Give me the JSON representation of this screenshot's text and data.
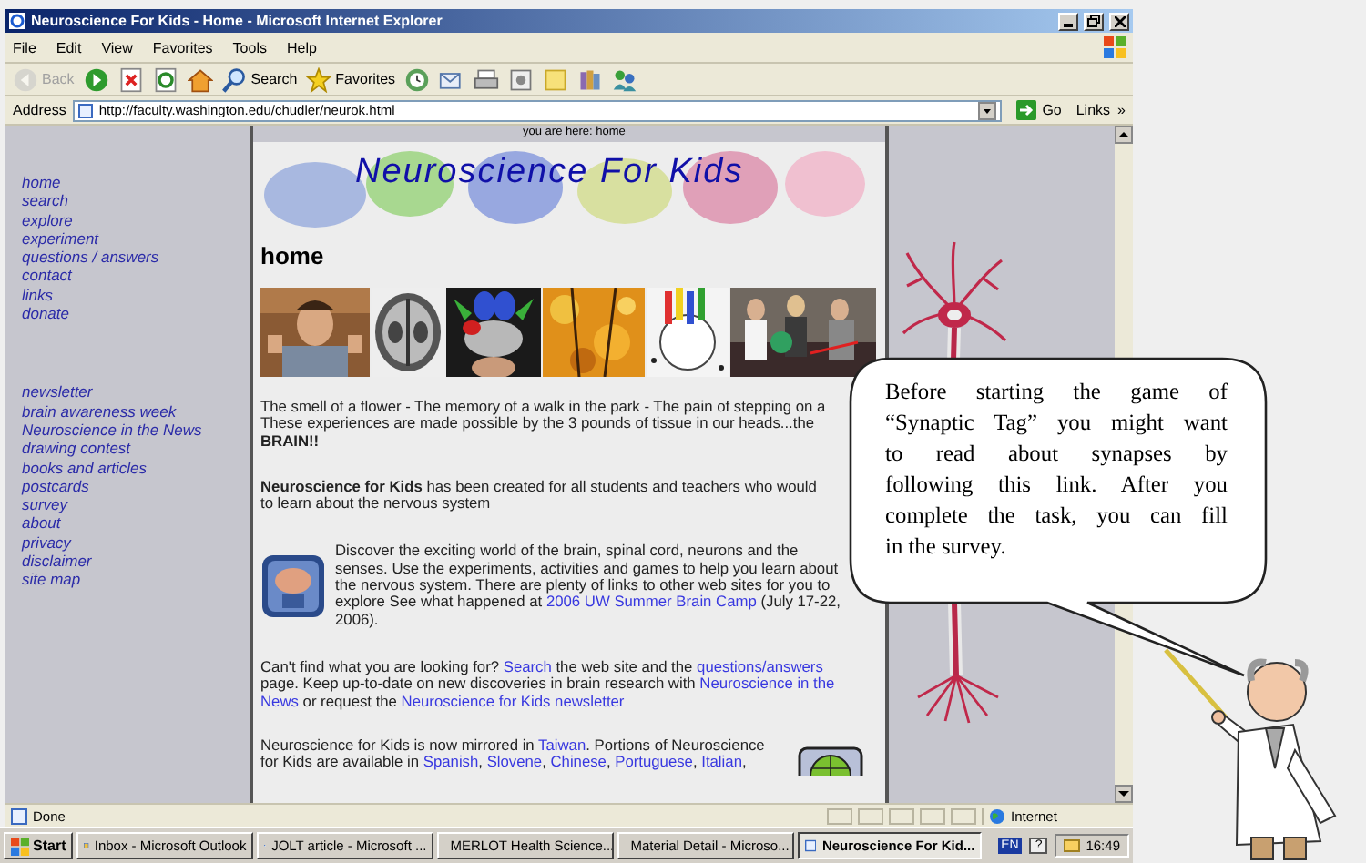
{
  "window": {
    "title": "Neuroscience For Kids - Home - Microsoft Internet Explorer"
  },
  "menu": [
    "File",
    "Edit",
    "View",
    "Favorites",
    "Tools",
    "Help"
  ],
  "toolbar": [
    {
      "kind": "back",
      "label": "Back",
      "disabled": true
    },
    {
      "kind": "forward",
      "disabled": false
    },
    {
      "kind": "stop",
      "disabled": false
    },
    {
      "kind": "refresh",
      "disabled": false
    },
    {
      "kind": "home",
      "disabled": false
    },
    {
      "kind": "search",
      "label": "Search",
      "disabled": false
    },
    {
      "kind": "favorites",
      "label": "Favorites",
      "disabled": false
    },
    {
      "kind": "history",
      "disabled": false
    },
    {
      "kind": "mail",
      "disabled": false
    },
    {
      "kind": "print",
      "disabled": false
    },
    {
      "kind": "edit",
      "disabled": false
    },
    {
      "kind": "note",
      "disabled": false
    },
    {
      "kind": "research",
      "disabled": false
    },
    {
      "kind": "messenger",
      "disabled": false
    }
  ],
  "address": {
    "label": "Address",
    "value": "http://faculty.washington.edu/chudler/neurok.html",
    "go": "Go",
    "links": "Links",
    "more": "»"
  },
  "page": {
    "breadcrumb": "you are here: home",
    "banner": "Neuroscience For Kids",
    "heading": "home",
    "nav_groups": [
      [
        "home",
        "search",
        "explore",
        "experiment",
        "questions / answers",
        "contact",
        "links",
        "donate"
      ],
      [
        "newsletter",
        "brain awareness week",
        "Neuroscience in the News",
        "drawing contest",
        "books and articles",
        "postcards",
        "survey",
        "about",
        "privacy",
        "disclaimer",
        "site map"
      ]
    ],
    "paragraphs": [
      {
        "lines": [
          [
            {
              "text": "The smell of a flower - The memory of a walk in the park - The pain of stepping on a",
              "kind": "plain"
            }
          ],
          [
            {
              "text": "These experiences are made possible by the 3 pounds of tissue in our heads...the",
              "kind": "plain"
            }
          ],
          [
            {
              "text": "BRAIN!!",
              "kind": "bold"
            }
          ]
        ]
      },
      {
        "lines": [
          [
            {
              "text": "Neuroscience for Kids",
              "kind": "bold"
            },
            {
              "text": " has been created for all students and teachers who would",
              "kind": "plain"
            }
          ],
          [
            {
              "text": "to learn about the nervous system",
              "kind": "plain"
            }
          ]
        ]
      },
      {
        "lines": [
          [
            {
              "text": "Discover the exciting world of the brain, spinal cord, neurons and the",
              "kind": "plain"
            }
          ],
          [
            {
              "text": "senses. Use the experiments, activities and games to help you learn about",
              "kind": "plain"
            }
          ],
          [
            {
              "text": "the nervous system. There are plenty of links to other web sites for you to",
              "kind": "plain"
            }
          ],
          [
            {
              "text": "explore  See what happened at ",
              "kind": "plain"
            },
            {
              "text": "2006 UW Summer Brain Camp",
              "kind": "link"
            },
            {
              "text": " (July 17-22,",
              "kind": "plain"
            }
          ],
          [
            {
              "text": "2006).",
              "kind": "plain"
            }
          ]
        ]
      },
      {
        "lines": [
          [
            {
              "text": "Can't find what you are looking for? ",
              "kind": "plain"
            },
            {
              "text": "Search",
              "kind": "link"
            },
            {
              "text": " the web site and the ",
              "kind": "plain"
            },
            {
              "text": "questions/answers",
              "kind": "link"
            }
          ],
          [
            {
              "text": "page. Keep up-to-date on new discoveries in brain research with ",
              "kind": "plain"
            },
            {
              "text": "Neuroscience in the",
              "kind": "link"
            }
          ],
          [
            {
              "text": "News",
              "kind": "link"
            },
            {
              "text": " or request the ",
              "kind": "plain"
            },
            {
              "text": "Neuroscience for Kids newsletter",
              "kind": "link"
            }
          ]
        ]
      },
      {
        "lines": [
          [
            {
              "text": "Neuroscience for Kids is now mirrored in ",
              "kind": "plain"
            },
            {
              "text": "Taiwan",
              "kind": "link"
            },
            {
              "text": ". Portions of Neuroscience",
              "kind": "plain"
            }
          ],
          [
            {
              "text": "for Kids are available in ",
              "kind": "plain"
            },
            {
              "text": "Spanish",
              "kind": "link"
            },
            {
              "text": ", ",
              "kind": "plain"
            },
            {
              "text": "Slovene",
              "kind": "link"
            },
            {
              "text": ", ",
              "kind": "plain"
            },
            {
              "text": "Chinese",
              "kind": "link"
            },
            {
              "text": ", ",
              "kind": "plain"
            },
            {
              "text": "Portuguese",
              "kind": "link"
            },
            {
              "text": ", ",
              "kind": "plain"
            },
            {
              "text": "Italian",
              "kind": "link"
            },
            {
              "text": ",",
              "kind": "plain"
            }
          ]
        ]
      }
    ]
  },
  "bubble": {
    "lines": [
      "Before starting the game of",
      "“Synaptic Tag” you might want",
      "to read about synapses by",
      "following this link. After you",
      "complete the task, you can fill",
      "in the survey."
    ]
  },
  "status": {
    "text": "Done",
    "zone": "Internet"
  },
  "taskbar": {
    "start": "Start",
    "tasks": [
      {
        "label": "Inbox - Microsoft Outlook",
        "selected": false
      },
      {
        "label": "JOLT article - Microsoft ...",
        "selected": false
      },
      {
        "label": "MERLOT Health Science...",
        "selected": false
      },
      {
        "label": "Material Detail - Microso...",
        "selected": false
      },
      {
        "label": "Neuroscience For Kid...",
        "selected": true
      }
    ],
    "language": "EN",
    "help": "?",
    "clock": "16:49"
  }
}
